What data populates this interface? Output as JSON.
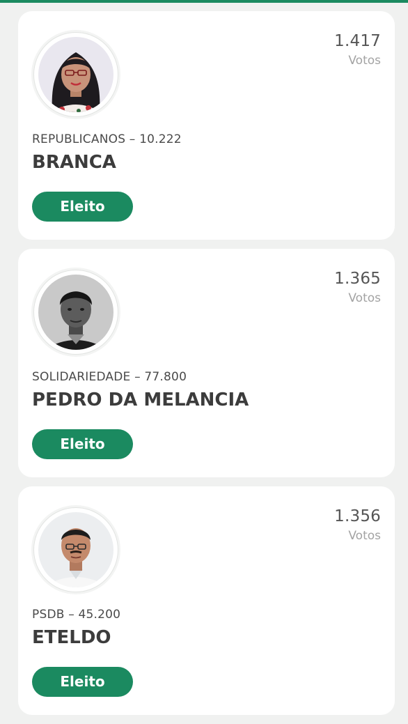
{
  "vote_label": "Votos",
  "colors": {
    "accent": "#1b8a60",
    "card": "#ffffff",
    "page_background": "#f0f1f0"
  },
  "candidates": [
    {
      "votes": "1.417",
      "party": "REPUBLICANOS – 10.222",
      "name": "BRANCA",
      "status": "Eleito",
      "photo": "candidate-photo-woman-glasses"
    },
    {
      "votes": "1.365",
      "party": "SOLIDARIEDADE – 77.800",
      "name": "PEDRO DA MELANCIA",
      "status": "Eleito",
      "photo": "candidate-photo-man-grayscale"
    },
    {
      "votes": "1.356",
      "party": "PSDB – 45.200",
      "name": "ETELDO",
      "status": "Eleito",
      "photo": "candidate-photo-man-glasses"
    }
  ]
}
